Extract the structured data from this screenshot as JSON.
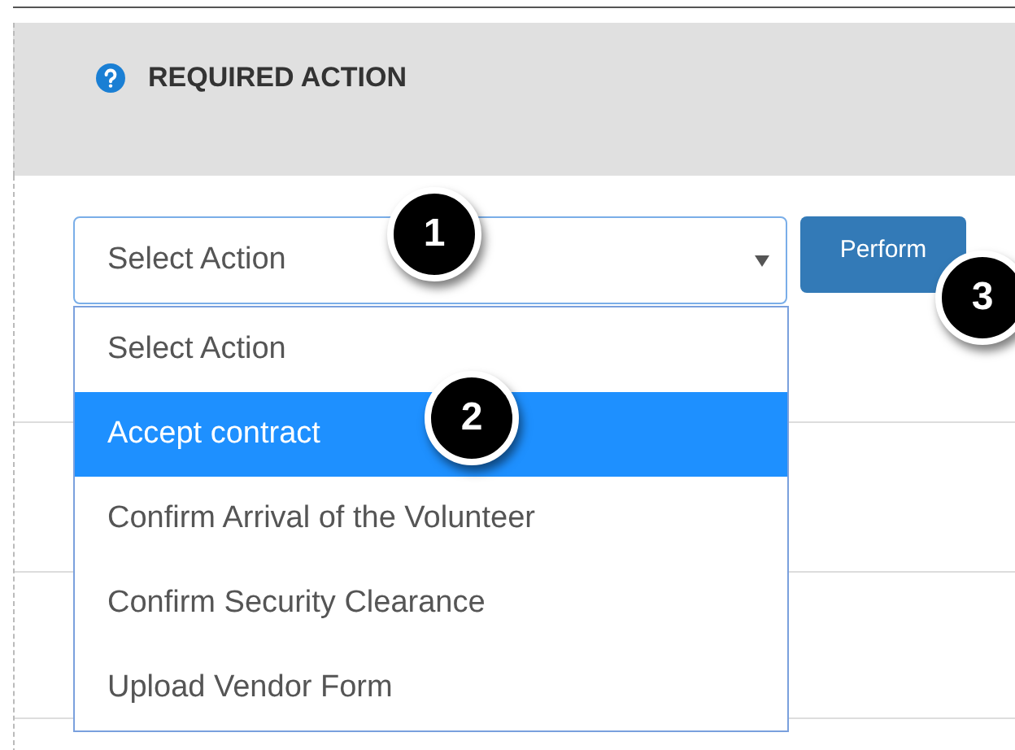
{
  "section": {
    "title": "REQUIRED ACTION"
  },
  "select": {
    "value": "Select Action",
    "expanded": true
  },
  "button": {
    "label": "Perform"
  },
  "options": [
    {
      "label": "Select Action",
      "selected": false
    },
    {
      "label": "Accept contract",
      "selected": true
    },
    {
      "label": "Confirm Arrival of the Volunteer",
      "selected": false
    },
    {
      "label": "Confirm Security Clearance",
      "selected": false
    },
    {
      "label": "Upload Vendor Form",
      "selected": false
    }
  ],
  "callouts": [
    {
      "label": "1"
    },
    {
      "label": "2"
    },
    {
      "label": "3"
    }
  ]
}
